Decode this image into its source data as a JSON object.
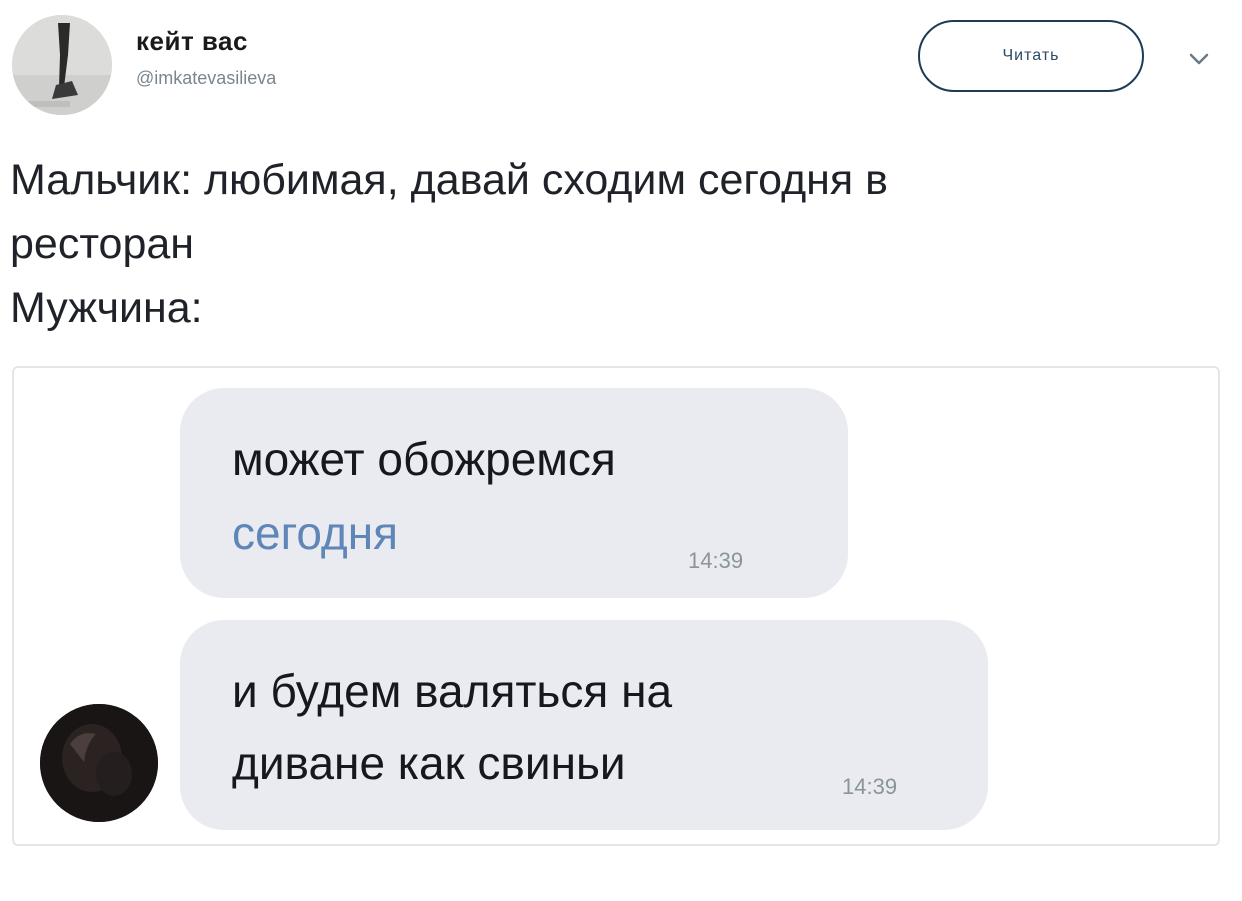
{
  "tweet": {
    "author_name": "кейт вас",
    "author_handle": "@imkatevasilieva",
    "follow_label": "Читать",
    "lines": [
      "Мальчик: любимая, давай сходим сегодня в",
      "ресторан",
      "Мужчина:"
    ]
  },
  "chat": {
    "messages": [
      {
        "line1": "может обожремся",
        "line2": "сегодня",
        "time": "14:39"
      },
      {
        "line1": "и будем валяться на",
        "line2": "диване как свиньи",
        "time": "14:39"
      }
    ]
  },
  "icons": {
    "more": "chevron-down-icon"
  },
  "colors": {
    "link_blue": "#5f86b8",
    "bubble_bg": "#e9ebf0",
    "follow_border": "#1d3b55"
  }
}
